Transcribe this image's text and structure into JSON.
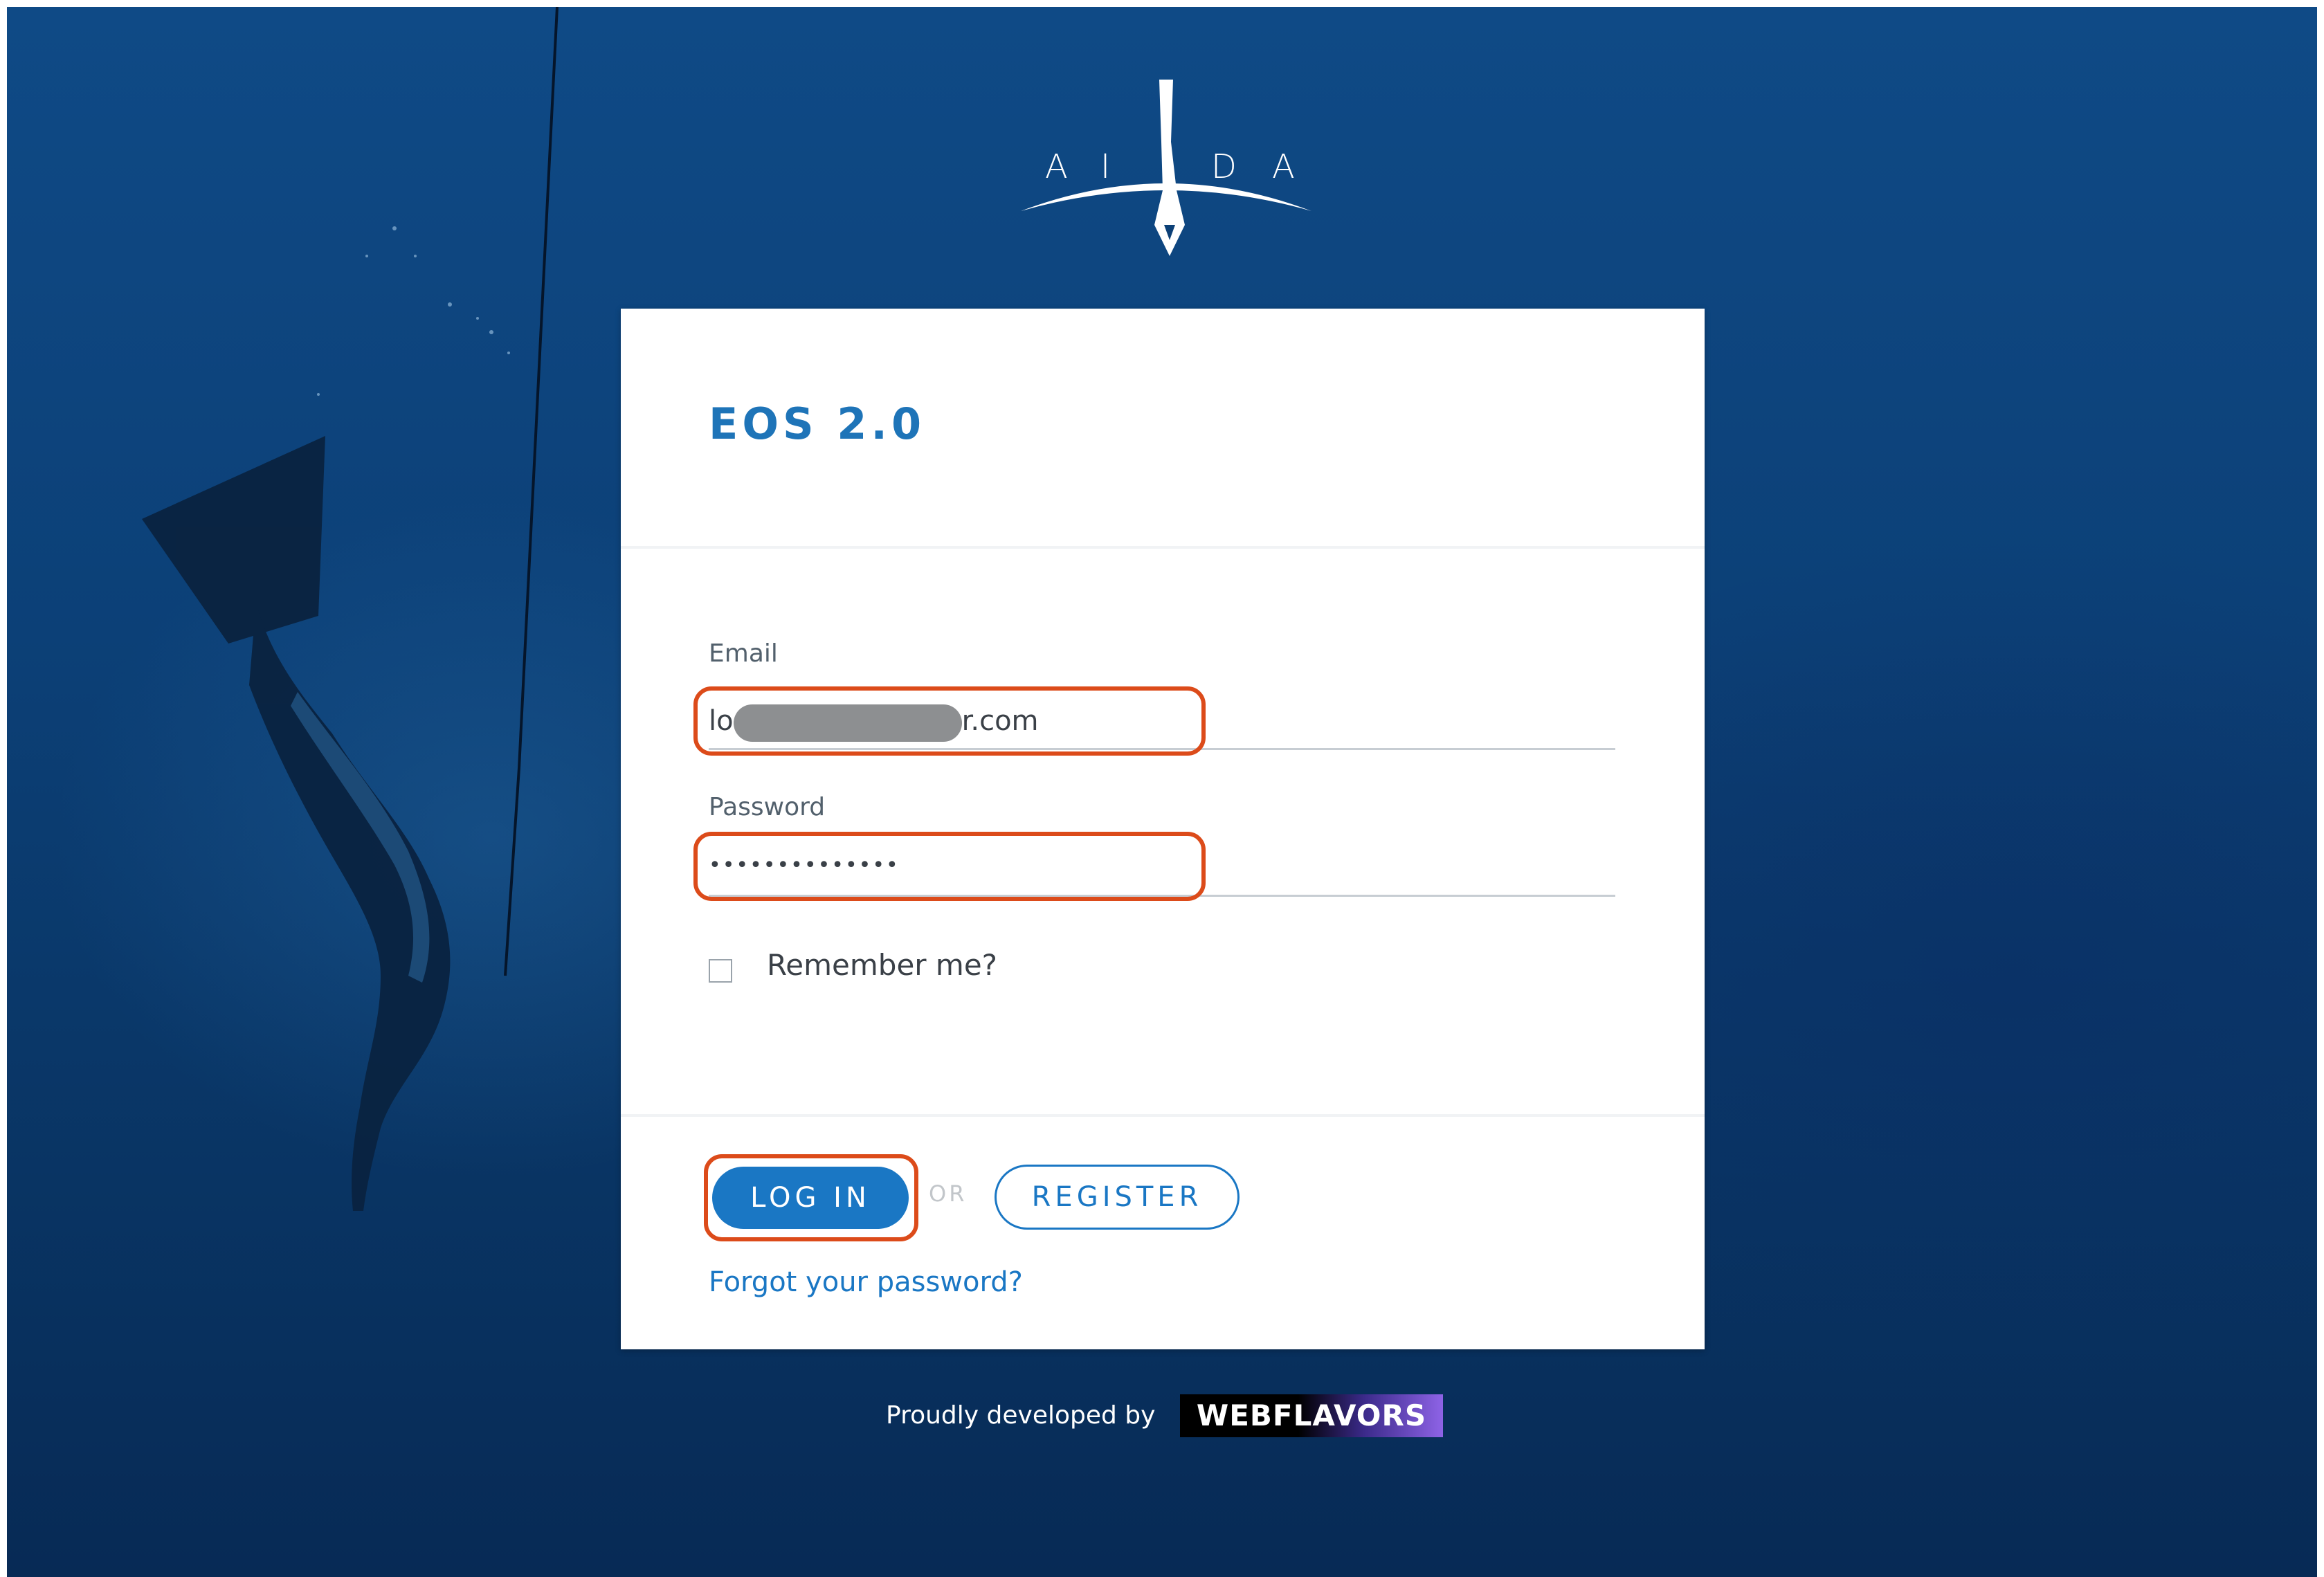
{
  "logo": {
    "letters": [
      "A",
      "I",
      "D",
      "A"
    ]
  },
  "card": {
    "title": "EOS 2.0",
    "email": {
      "label": "Email",
      "value_prefix": "lo",
      "value_suffix": "r.com"
    },
    "password": {
      "label": "Password",
      "value": "••••••••••••••"
    },
    "remember": {
      "label": "Remember me?",
      "checked": false
    },
    "actions": {
      "login_label": "LOG IN",
      "or_label": "OR",
      "register_label": "REGISTER",
      "forgot_label": "Forgot your password?"
    }
  },
  "footer": {
    "credit_text": "Proudly developed by",
    "brand_name": "WEBFLAVORS"
  },
  "colors": {
    "accent": "#1a77c4",
    "highlight": "#dc4b1a",
    "background": "#0c4077"
  }
}
